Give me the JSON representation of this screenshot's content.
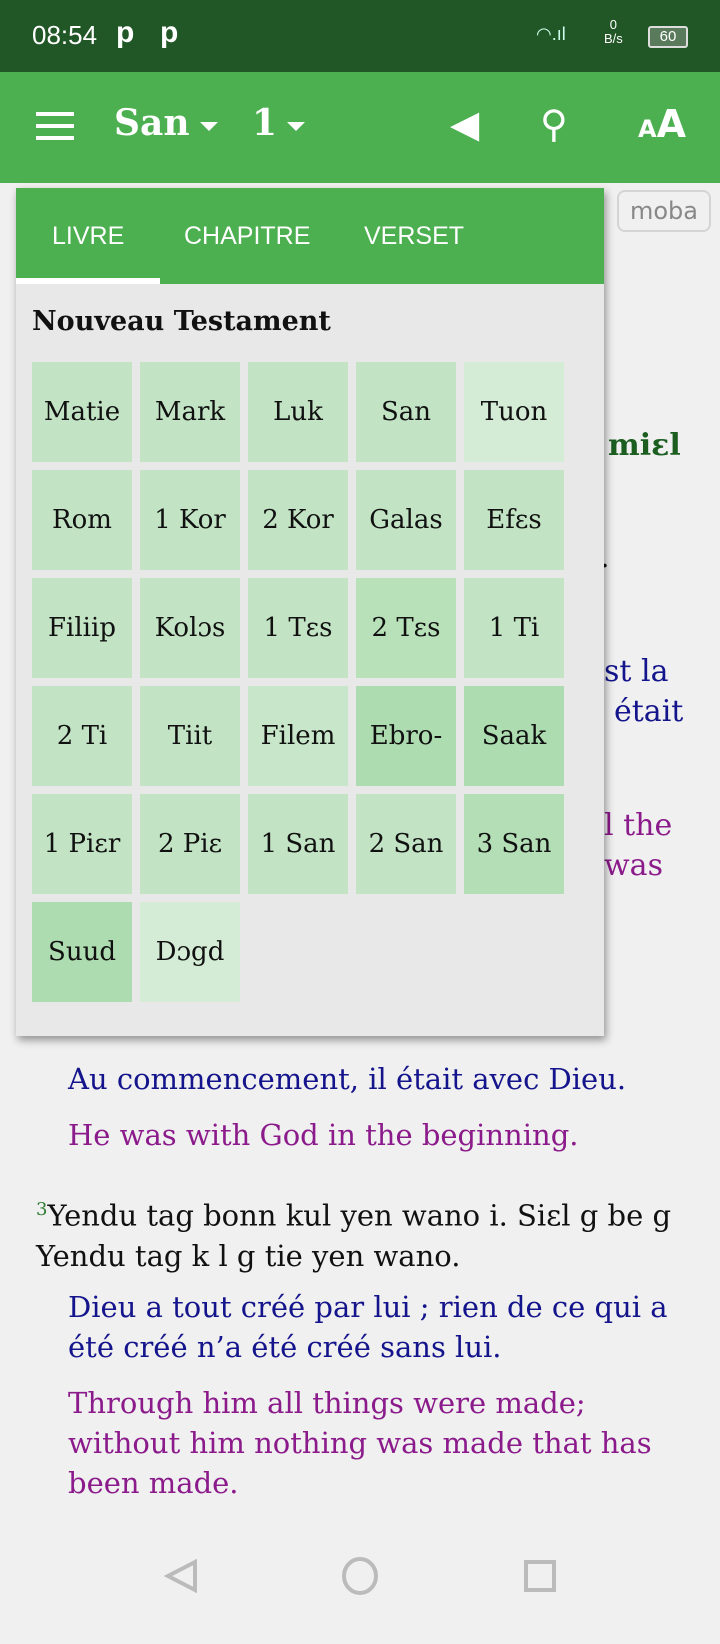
{
  "status": {
    "time": "08:54",
    "notif": [
      "p",
      "p"
    ],
    "net_speed": "0",
    "net_unit": "B/s",
    "battery": "60"
  },
  "appbar": {
    "book": "San",
    "chapter": "1"
  },
  "badge": "moba",
  "background_fragments": {
    "heading": "miɛl",
    "dot": ".",
    "fr1": "st la",
    "fr2": "était",
    "en1": "l the",
    "en2": "was"
  },
  "verses": [
    {
      "fr": "Au commencement, il était avec Dieu.",
      "en": "He was with God in the beginning."
    },
    {
      "num": "3",
      "mo": "Yendu tag bonn kul yen wano i. Siɛl g be g Yendu tag k l g tie yen wano.",
      "fr": "Dieu a tout créé par lui ; rien de ce qui a été créé n’a été créé sans lui.",
      "en": "Through him all things were made; without him nothing was made that has been made."
    }
  ],
  "popup": {
    "tabs": [
      "LIVRE",
      "CHAPITRE",
      "VERSET"
    ],
    "active_tab": "LIVRE",
    "section_title": "Nouveau Testament",
    "books": [
      "Matie",
      "Mark",
      "Luk",
      "San",
      "Tuon",
      "Rom",
      "1 Kor",
      "2 Kor",
      "Galas",
      "Efɛs",
      "Filiip",
      "Kolɔs",
      "1 Tɛs",
      "2 Tɛs",
      "1 Ti",
      "2 Ti",
      "Tiit",
      "Filem",
      "Ebro-",
      "Saak",
      "1 Piɛr",
      "2 Piɛ",
      "1 San",
      "2 San",
      "3 San",
      "Suud",
      "Dɔgd"
    ]
  },
  "colors": {
    "primary": "#4caf50",
    "status_bar": "#215626",
    "french": "#14148c",
    "english": "#8b1a8b",
    "heading": "#1b5e20"
  }
}
